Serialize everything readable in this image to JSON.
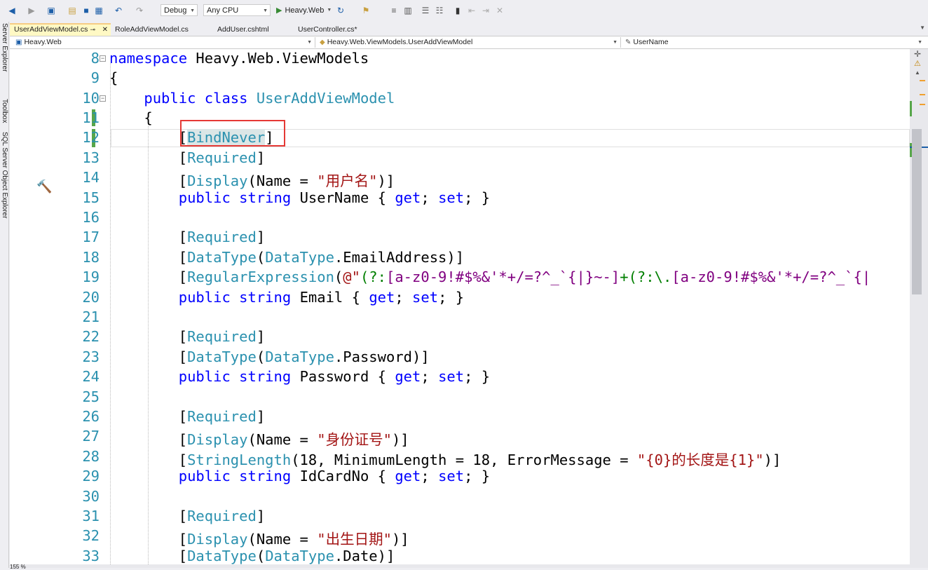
{
  "toolbar": {
    "config": "Debug",
    "platform": "Any CPU",
    "start_label": "Heavy.Web"
  },
  "side_panels": [
    "Server Explorer",
    "Toolbox",
    "SQL Server Object Explorer"
  ],
  "tabs": [
    {
      "label": "UserAddViewModel.cs",
      "active": true
    },
    {
      "label": "RoleAddViewModel.cs"
    },
    {
      "label": "AddUser.cshtml"
    },
    {
      "label": "UserController.cs*"
    }
  ],
  "nav": {
    "project": "Heavy.Web",
    "type": "Heavy.Web.ViewModels.UserAddViewModel",
    "member": "UserName"
  },
  "code": {
    "line_numbers": [
      "8",
      "9",
      "10",
      "11",
      "12",
      "13",
      "14",
      "15",
      "16",
      "17",
      "18",
      "19",
      "20",
      "21",
      "22",
      "23",
      "24",
      "25",
      "26",
      "27",
      "28",
      "29",
      "30",
      "31",
      "32",
      "33"
    ],
    "l8_kw": "namespace",
    "l8_rest": " Heavy.Web.ViewModels",
    "l9": "{",
    "l10_kw1": "public",
    "l10_kw2": "class",
    "l10_type": "UserAddViewModel",
    "l11": "{",
    "attr_bindnever": "BindNever",
    "attr_required": "Required",
    "attr_display": "Display",
    "name_kw": "Name",
    "str_username": "\"用户名\"",
    "kw_public": "public",
    "kw_string": "string",
    "prop_username": "UserName",
    "kw_get": "get",
    "kw_set": "set",
    "attr_datatype": "DataType",
    "email_address": "EmailAddress",
    "attr_regex": "RegularExpression",
    "regex_part1": "(?:",
    "regex_part2": "[a-z0-9!#$%&'*+/=?^_`{|}~-]",
    "regex_part3": "+",
    "regex_part4": "(?:\\.",
    "regex_part5": "[a-z0-9!#$%&'*+/=?^_`{|",
    "prop_email": "Email",
    "password": "Password",
    "prop_password": "Password",
    "str_idcard": "\"身份证号\"",
    "attr_stringlength": "StringLength",
    "num_18": "18",
    "minlen": "MinimumLength",
    "errmsg": "ErrorMessage",
    "str_errmsg": "\"{0}的长度是{1}\"",
    "prop_idcard": "IdCardNo",
    "str_birth": "\"出生日期\"",
    "date": "Date"
  },
  "status": {
    "zoom": "155 %"
  }
}
